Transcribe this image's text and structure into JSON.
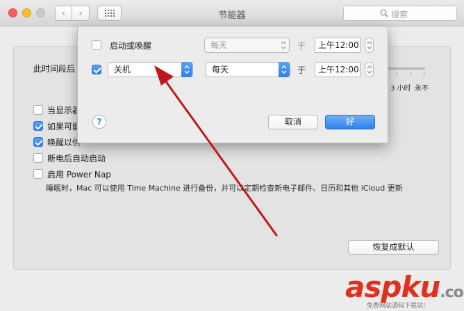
{
  "window": {
    "title": "节能器",
    "search_placeholder": "搜索"
  },
  "main": {
    "sleep_label": "此时间段后",
    "slider_labels": [
      "3 小时",
      "永不"
    ],
    "options": [
      {
        "label": "当显示器",
        "checked": false
      },
      {
        "label": "如果可能",
        "checked": true
      },
      {
        "label": "唤醒以供",
        "checked": true
      },
      {
        "label": "断电后自动启动",
        "checked": false
      },
      {
        "label": "启用 Power Nap",
        "checked": false
      }
    ],
    "power_nap_desc": "睡眠时，Mac 可以使用 Time Machine 进行备份，并可以定期检查新电子邮件、日历和其他 iCloud 更新",
    "restore_button": "恢复成默认"
  },
  "sheet": {
    "rows": [
      {
        "checked": false,
        "label": "启动或唤醒",
        "frequency": "每天",
        "at": "于",
        "time": "上午12:00"
      },
      {
        "checked": true,
        "action": "关机",
        "frequency": "每天",
        "at": "于",
        "time": "上午12:00"
      }
    ],
    "help": "?",
    "cancel_button": "取消",
    "ok_button": "好"
  },
  "watermark": {
    "brand": "aspku",
    "tld": ".com",
    "sub": "免费网站源码下载站!"
  },
  "colors": {
    "accent": "#2f80ea",
    "annotation_arrow": "#c0171b",
    "watermark": "#e0301e"
  }
}
